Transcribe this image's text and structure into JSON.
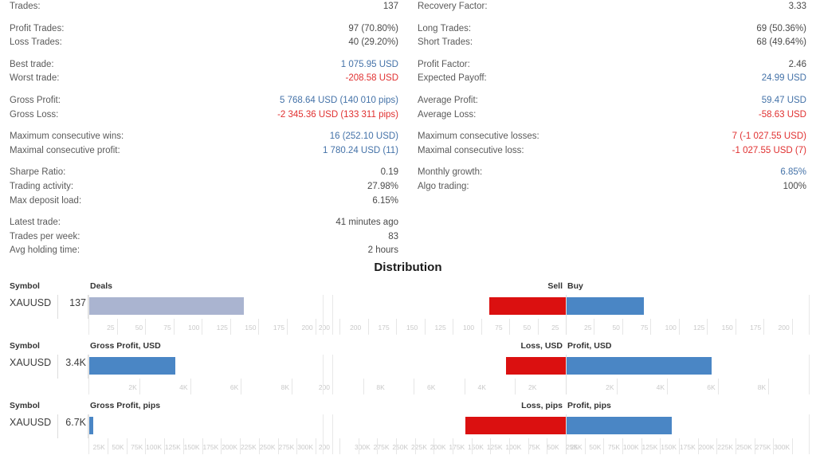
{
  "stats": {
    "left_groups": [
      [
        {
          "label": "Trades:",
          "value": "137",
          "style": "plain"
        }
      ],
      [
        {
          "label": "Profit Trades:",
          "value": "97 (70.80%)",
          "style": "plain"
        },
        {
          "label": "Loss Trades:",
          "value": "40 (29.20%)",
          "style": "plain"
        }
      ],
      [
        {
          "label": "Best trade:",
          "value": "1 075.95 USD",
          "style": "blue"
        },
        {
          "label": "Worst trade:",
          "value": "-208.58 USD",
          "style": "red"
        }
      ],
      [
        {
          "label": "Gross Profit:",
          "value": "5 768.64 USD (140 010 pips)",
          "style": "blue"
        },
        {
          "label": "Gross Loss:",
          "value": "-2 345.36 USD (133 311 pips)",
          "style": "red"
        }
      ],
      [
        {
          "label": "Maximum consecutive wins:",
          "value": "16 (252.10 USD)",
          "style": "blue"
        },
        {
          "label": "Maximal consecutive profit:",
          "value": "1 780.24 USD (11)",
          "style": "blue"
        }
      ],
      [
        {
          "label": "Sharpe Ratio:",
          "value": "0.19",
          "style": "plain"
        },
        {
          "label": "Trading activity:",
          "value": "27.98%",
          "style": "plain"
        },
        {
          "label": "Max deposit load:",
          "value": "6.15%",
          "style": "plain"
        }
      ],
      [
        {
          "label": "Latest trade:",
          "value": "41 minutes ago",
          "style": "plain"
        },
        {
          "label": "Trades per week:",
          "value": "83",
          "style": "plain"
        },
        {
          "label": "Avg holding time:",
          "value": "2 hours",
          "style": "plain"
        }
      ]
    ],
    "right_groups": [
      [
        {
          "label": "Recovery Factor:",
          "value": "3.33",
          "style": "plain"
        }
      ],
      [
        {
          "label": "Long Trades:",
          "value": "69 (50.36%)",
          "style": "plain"
        },
        {
          "label": "Short Trades:",
          "value": "68 (49.64%)",
          "style": "plain"
        }
      ],
      [
        {
          "label": "Profit Factor:",
          "value": "2.46",
          "style": "plain"
        },
        {
          "label": "Expected Payoff:",
          "value": "24.99 USD",
          "style": "blue"
        }
      ],
      [
        {
          "label": "Average Profit:",
          "value": "59.47 USD",
          "style": "blue"
        },
        {
          "label": "Average Loss:",
          "value": "-58.63 USD",
          "style": "red"
        }
      ],
      [
        {
          "label": "Maximum consecutive losses:",
          "value": "7 (-1 027.55 USD)",
          "style": "red"
        },
        {
          "label": "Maximal consecutive loss:",
          "value": "-1 027.55 USD (7)",
          "style": "red"
        }
      ],
      [
        {
          "label": "Monthly growth:",
          "value": "6.85%",
          "style": "blue"
        },
        {
          "label": "Algo trading:",
          "value": "100%",
          "style": "plain"
        }
      ]
    ]
  },
  "distribution": {
    "title": "Distribution",
    "symbol_header": "Symbol",
    "symbol": "XAUUSD",
    "charts": [
      {
        "left_header": "Deals",
        "neg_header": "Sell",
        "pos_header": "Buy",
        "summary_value": "137",
        "left_bar_value": 137,
        "left_axis_max": 215,
        "left_ticks": [
          25,
          50,
          75,
          100,
          125,
          150,
          175,
          200
        ],
        "left_tick_labels": [
          "25",
          "50",
          "75",
          "100",
          "125",
          "150",
          "175",
          "200"
        ],
        "neg_value": 68,
        "pos_value": 69,
        "split_axis_max": 215,
        "split_ticks": [
          25,
          50,
          75,
          100,
          125,
          150,
          175,
          200
        ],
        "split_tick_labels": [
          "25",
          "50",
          "75",
          "100",
          "125",
          "150",
          "175",
          "200"
        ]
      },
      {
        "left_header": "Gross Profit, USD",
        "neg_header": "Loss, USD",
        "pos_header": "Profit, USD",
        "summary_value": "3.4K",
        "left_bar_value": 3423,
        "left_axis_max": 9600,
        "left_ticks": [
          2000,
          4000,
          6000,
          8000
        ],
        "left_tick_labels": [
          "2K",
          "4K",
          "6K",
          "8K"
        ],
        "neg_value": 2345,
        "pos_value": 5769,
        "split_axis_max": 9600,
        "split_ticks": [
          2000,
          4000,
          6000,
          8000
        ],
        "split_tick_labels": [
          "2K",
          "4K",
          "6K",
          "8K"
        ]
      },
      {
        "left_header": "Gross Profit, pips",
        "neg_header": "Loss, pips",
        "pos_header": "Profit, pips",
        "summary_value": "6.7K",
        "left_bar_value": 6699,
        "left_axis_max": 322000,
        "left_ticks": [
          25000,
          50000,
          75000,
          100000,
          125000,
          150000,
          175000,
          200000,
          225000,
          250000,
          275000,
          300000
        ],
        "left_tick_labels": [
          "25K",
          "50K",
          "75K",
          "100K",
          "125K",
          "150K",
          "175K",
          "200K",
          "225K",
          "250K",
          "275K",
          "300K"
        ],
        "neg_value": 133311,
        "pos_value": 140010,
        "split_axis_max": 322000,
        "split_ticks": [
          25000,
          50000,
          75000,
          100000,
          125000,
          150000,
          175000,
          200000,
          225000,
          250000,
          275000,
          300000
        ],
        "split_tick_labels": [
          "25K",
          "50K",
          "75K",
          "100K",
          "125K",
          "150K",
          "175K",
          "200K",
          "225K",
          "250K",
          "275K",
          "300K"
        ]
      }
    ]
  },
  "chart_data": [
    {
      "type": "bar",
      "title": "Deals",
      "categories": [
        "XAUUSD"
      ],
      "values": [
        137
      ],
      "xlabel": "",
      "ylabel": "Deals",
      "xlim": [
        0,
        215
      ],
      "tick_labels": [
        "25",
        "50",
        "75",
        "100",
        "125",
        "150",
        "175",
        "200"
      ],
      "grid": true,
      "legend": "none"
    },
    {
      "type": "bar",
      "title": "Sell / Buy",
      "categories": [
        "XAUUSD"
      ],
      "series": [
        {
          "name": "Sell",
          "values": [
            68
          ],
          "color": "#db1010",
          "direction": "left"
        },
        {
          "name": "Buy",
          "values": [
            69
          ],
          "color": "#4a86c5",
          "direction": "right"
        }
      ],
      "xlim": [
        -215,
        215
      ],
      "tick_labels": [
        "200",
        "175",
        "150",
        "125",
        "100",
        "75",
        "50",
        "25",
        "25",
        "50",
        "75",
        "100",
        "125",
        "150",
        "175",
        "200"
      ],
      "grid": true,
      "legend": "top"
    },
    {
      "type": "bar",
      "title": "Gross Profit, USD",
      "categories": [
        "XAUUSD"
      ],
      "values": [
        3423
      ],
      "value_label": "3.4K",
      "xlim": [
        0,
        9600
      ],
      "tick_labels": [
        "2K",
        "4K",
        "6K",
        "8K"
      ],
      "grid": true,
      "legend": "none"
    },
    {
      "type": "bar",
      "title": "Loss, USD / Profit, USD",
      "categories": [
        "XAUUSD"
      ],
      "series": [
        {
          "name": "Loss, USD",
          "values": [
            2345
          ],
          "color": "#db1010",
          "direction": "left"
        },
        {
          "name": "Profit, USD",
          "values": [
            5769
          ],
          "color": "#4a86c5",
          "direction": "right"
        }
      ],
      "xlim": [
        -9600,
        9600
      ],
      "tick_labels": [
        "8K",
        "6K",
        "4K",
        "2K",
        "2K",
        "4K",
        "6K",
        "8K"
      ],
      "grid": true,
      "legend": "top"
    },
    {
      "type": "bar",
      "title": "Gross Profit, pips",
      "categories": [
        "XAUUSD"
      ],
      "values": [
        6699
      ],
      "value_label": "6.7K",
      "xlim": [
        0,
        322000
      ],
      "tick_labels": [
        "25K",
        "50K",
        "75K",
        "100K",
        "125K",
        "150K",
        "175K",
        "200K",
        "225K",
        "250K",
        "275K",
        "300K"
      ],
      "grid": true,
      "legend": "none"
    },
    {
      "type": "bar",
      "title": "Loss, pips / Profit, pips",
      "categories": [
        "XAUUSD"
      ],
      "series": [
        {
          "name": "Loss, pips",
          "values": [
            133311
          ],
          "color": "#db1010",
          "direction": "left"
        },
        {
          "name": "Profit, pips",
          "values": [
            140010
          ],
          "color": "#4a86c5",
          "direction": "right"
        }
      ],
      "xlim": [
        -322000,
        322000
      ],
      "tick_labels": [
        "300K",
        "275K",
        "250K",
        "225K",
        "200K",
        "175K",
        "150K",
        "125K",
        "100K",
        "75K",
        "50K",
        "25K",
        "25K",
        "50K",
        "75K",
        "100K",
        "125K",
        "150K",
        "175K",
        "200K",
        "225K",
        "250K",
        "275K",
        "300K"
      ],
      "grid": true,
      "legend": "top"
    }
  ],
  "colors": {
    "blue_text": "#4472a8",
    "red_text": "#e03030",
    "bar_blue": "#4a86c5",
    "bar_red": "#db1010",
    "bar_deals": "#aab4d0"
  }
}
